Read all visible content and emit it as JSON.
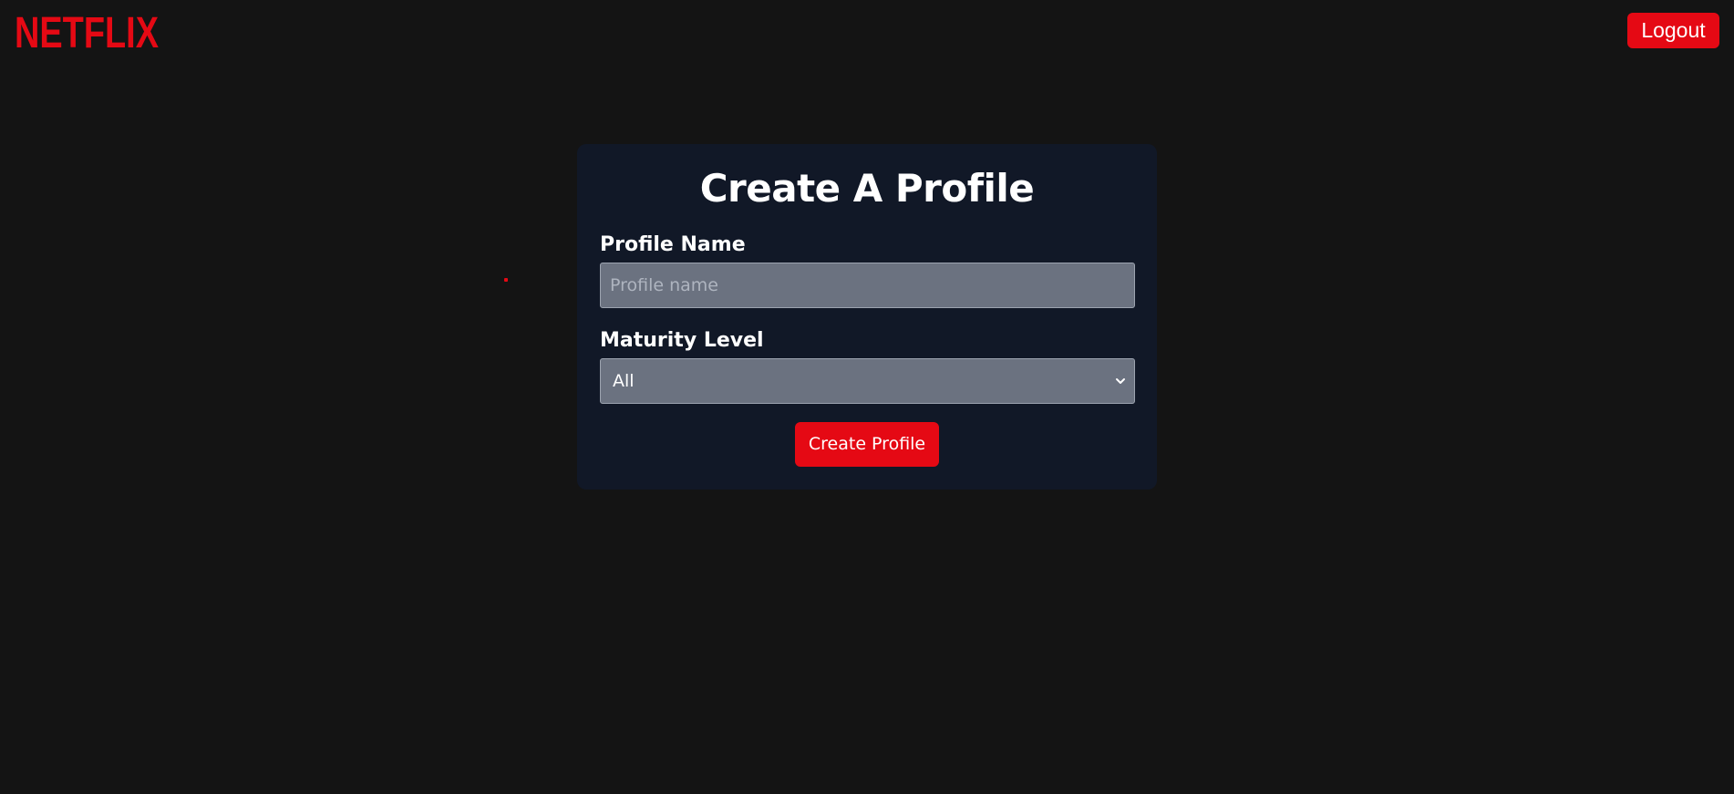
{
  "header": {
    "logo_text": "NETFLIX",
    "logout_label": "Logout"
  },
  "form": {
    "title": "Create A Profile",
    "profile_name_label": "Profile Name",
    "profile_name_placeholder": "Profile name",
    "profile_name_value": "",
    "maturity_label": "Maturity Level",
    "maturity_selected": "All",
    "submit_label": "Create Profile"
  },
  "icons": {
    "select_arrow": "chevron-down-icon"
  },
  "colors": {
    "brand_red": "#e50914",
    "background": "#141414",
    "card": "#111827",
    "input": "#6b7280"
  }
}
